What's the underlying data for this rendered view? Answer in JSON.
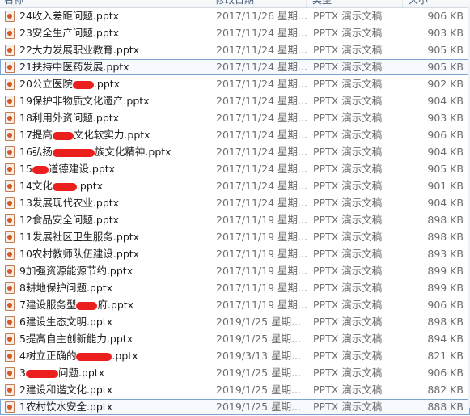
{
  "header": {
    "name_label": "名称",
    "date_label": "修改日期",
    "type_label": "类型",
    "size_label": "大小"
  },
  "files": [
    {
      "name": "24收入差距问题.pptx",
      "date": "2017/11/26 星期...",
      "type": "PPTX 演示文稿",
      "size": "906 KB",
      "selected": false
    },
    {
      "name": "23安全生产问题.pptx",
      "date": "2017/11/24 星期...",
      "type": "PPTX 演示文稿",
      "size": "903 KB",
      "selected": false
    },
    {
      "name": "22大力发展职业教育.pptx",
      "date": "2017/11/24 星期...",
      "type": "PPTX 演示文稿",
      "size": "905 KB",
      "selected": false
    },
    {
      "name": "21扶持中医药发展.pptx",
      "date": "2017/11/24 星期...",
      "type": "PPTX 演示文稿",
      "size": "905 KB",
      "selected": true
    },
    {
      "name": "20公立医院",
      "name_after": ".pptx",
      "date": "2017/11/24 星期...",
      "type": "PPTX 演示文稿",
      "size": "902 KB",
      "selected": false
    },
    {
      "name": "19保护非物质文化遗产.pptx",
      "date": "2017/11/24 星期...",
      "type": "PPTX 演示文稿",
      "size": "904 KB",
      "selected": false
    },
    {
      "name": "18利用外资问题.pptx",
      "date": "2017/11/24 星期...",
      "type": "PPTX 演示文稿",
      "size": "903 KB",
      "selected": false
    },
    {
      "name": "17提高",
      "name_after": "文化软实力.pptx",
      "date": "2017/11/24 星期...",
      "type": "PPTX 演示文稿",
      "size": "906 KB",
      "selected": false
    },
    {
      "name": "16弘扬",
      "name_after": "族文化精神.pptx",
      "date": "2017/11/24 星期...",
      "type": "PPTX 演示文稿",
      "size": "904 KB",
      "selected": false
    },
    {
      "name": "15",
      "name_after": "道德建设.pptx",
      "date": "2017/11/24 星期...",
      "type": "PPTX 演示文稿",
      "size": "905 KB",
      "selected": false
    },
    {
      "name": "14文化",
      "name_after": ".pptx",
      "date": "2017/11/24 星期...",
      "type": "PPTX 演示文稿",
      "size": "901 KB",
      "selected": false
    },
    {
      "name": "13发展现代农业.pptx",
      "date": "2017/11/24 星期...",
      "type": "PPTX 演示文稿",
      "size": "904 KB",
      "selected": false
    },
    {
      "name": "12食品安全问题.pptx",
      "date": "2017/11/19 星期...",
      "type": "PPTX 演示文稿",
      "size": "898 KB",
      "selected": false
    },
    {
      "name": "11发展社区卫生服务.pptx",
      "date": "2017/11/19 星期...",
      "type": "PPTX 演示文稿",
      "size": "898 KB",
      "selected": false
    },
    {
      "name": "10农村教师队伍建设.pptx",
      "date": "2017/11/19 星期...",
      "type": "PPTX 演示文稿",
      "size": "893 KB",
      "selected": false
    },
    {
      "name": "9加强资源能源节约.pptx",
      "date": "2017/11/19 星期...",
      "type": "PPTX 演示文稿",
      "size": "899 KB",
      "selected": false
    },
    {
      "name": "8耕地保护问题.pptx",
      "date": "2017/11/19 星期...",
      "type": "PPTX 演示文稿",
      "size": "899 KB",
      "selected": false
    },
    {
      "name": "7建设服务型",
      "name_after": "府.pptx",
      "date": "2017/11/19 星期...",
      "type": "PPTX 演示文稿",
      "size": "906 KB",
      "selected": false
    },
    {
      "name": "6建设生态文明.pptx",
      "date": "2019/1/25 星期...",
      "type": "PPTX 演示文稿",
      "size": "898 KB",
      "selected": false
    },
    {
      "name": "5提高自主创新能力.pptx",
      "date": "2019/1/25 星期...",
      "type": "PPTX 演示文稿",
      "size": "894 KB",
      "selected": false
    },
    {
      "name": "4树立正确的",
      "name_after": ".pptx",
      "date": "2019/3/13 星期...",
      "type": "PPTX 演示文稿",
      "size": "821 KB",
      "selected": false
    },
    {
      "name": "3",
      "name_after": "问题.pptx",
      "date": "2019/1/25 星期...",
      "type": "PPTX 演示文稿",
      "size": "906 KB",
      "selected": false
    },
    {
      "name": "2建设和谐文化.pptx",
      "date": "2019/1/25 星期...",
      "type": "PPTX 演示文稿",
      "size": "882 KB",
      "selected": false
    },
    {
      "name": "1农村饮水安全.pptx",
      "date": "2019/1/25 星期...",
      "type": "PPTX 演示文稿",
      "size": "888 KB",
      "selected": true
    }
  ],
  "colors": {
    "redaction": "#ec1f1f",
    "selection_border": "#7da2ce",
    "icon_accent": "#d4582a"
  }
}
